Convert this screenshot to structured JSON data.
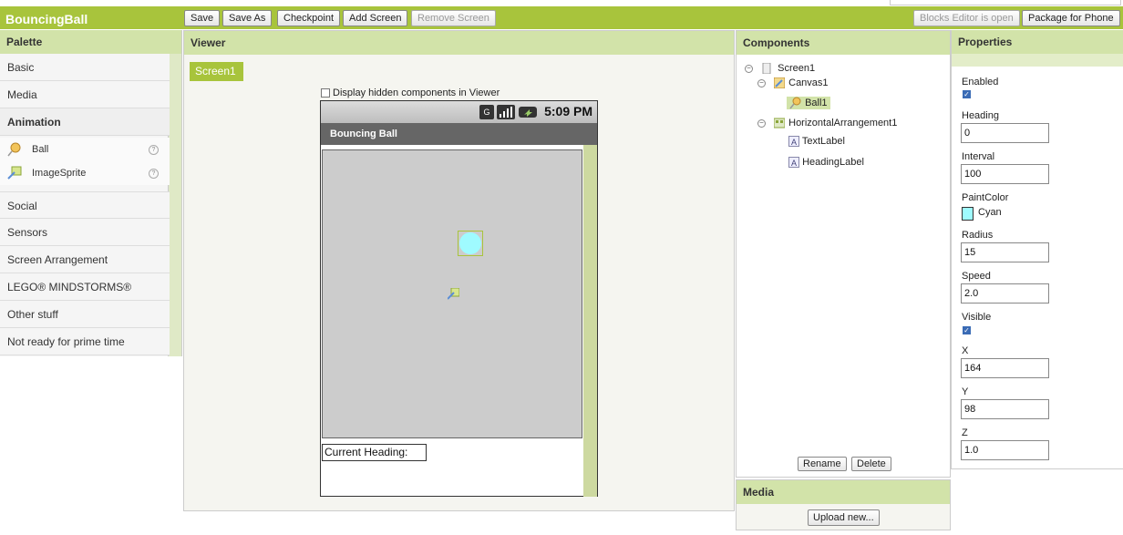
{
  "app": {
    "title": "BouncingBall"
  },
  "toolbar": {
    "save": "Save",
    "save_as": "Save As",
    "checkpoint": "Checkpoint",
    "add_screen": "Add Screen",
    "remove_screen": "Remove Screen",
    "blocks_editor": "Blocks Editor is open",
    "package": "Package for Phone"
  },
  "palette": {
    "header": "Palette",
    "categories": [
      "Basic",
      "Media",
      "Animation",
      "Social",
      "Sensors",
      "Screen Arrangement",
      "LEGO® MINDSTORMS®",
      "Other stuff",
      "Not ready for prime time"
    ],
    "animation_items": [
      {
        "label": "Ball",
        "icon": "ball-icon",
        "help": "?"
      },
      {
        "label": "ImageSprite",
        "icon": "image-sprite-icon",
        "help": "?"
      }
    ]
  },
  "viewer": {
    "header": "Viewer",
    "screen_tab": "Screen1",
    "hidden_checkbox_label": "Display hidden components in Viewer",
    "phone": {
      "clock": "5:09 PM",
      "app_title": "Bouncing Ball",
      "label_text": "Current Heading:",
      "ball_color": "#9ffbff"
    }
  },
  "components": {
    "header": "Components",
    "tree": {
      "screen": "Screen1",
      "canvas": "Canvas1",
      "ball": "Ball1",
      "arrangement": "HorizontalArrangement1",
      "text_label": "TextLabel",
      "heading_label": "HeadingLabel"
    },
    "rename": "Rename",
    "delete": "Delete"
  },
  "media": {
    "header": "Media",
    "upload": "Upload new..."
  },
  "properties": {
    "header": "Properties",
    "enabled_label": "Enabled",
    "enabled": true,
    "heading_label": "Heading",
    "heading": "0",
    "interval_label": "Interval",
    "interval": "100",
    "paintcolor_label": "PaintColor",
    "paintcolor": "Cyan",
    "paintcolor_hex": "#9ffbff",
    "radius_label": "Radius",
    "radius": "15",
    "speed_label": "Speed",
    "speed": "2.0",
    "visible_label": "Visible",
    "visible": true,
    "x_label": "X",
    "x": "164",
    "y_label": "Y",
    "y": "98",
    "z_label": "Z",
    "z": "1.0"
  },
  "colors": {
    "accent": "#a8c43c",
    "header_bg": "#d2e3a9"
  }
}
